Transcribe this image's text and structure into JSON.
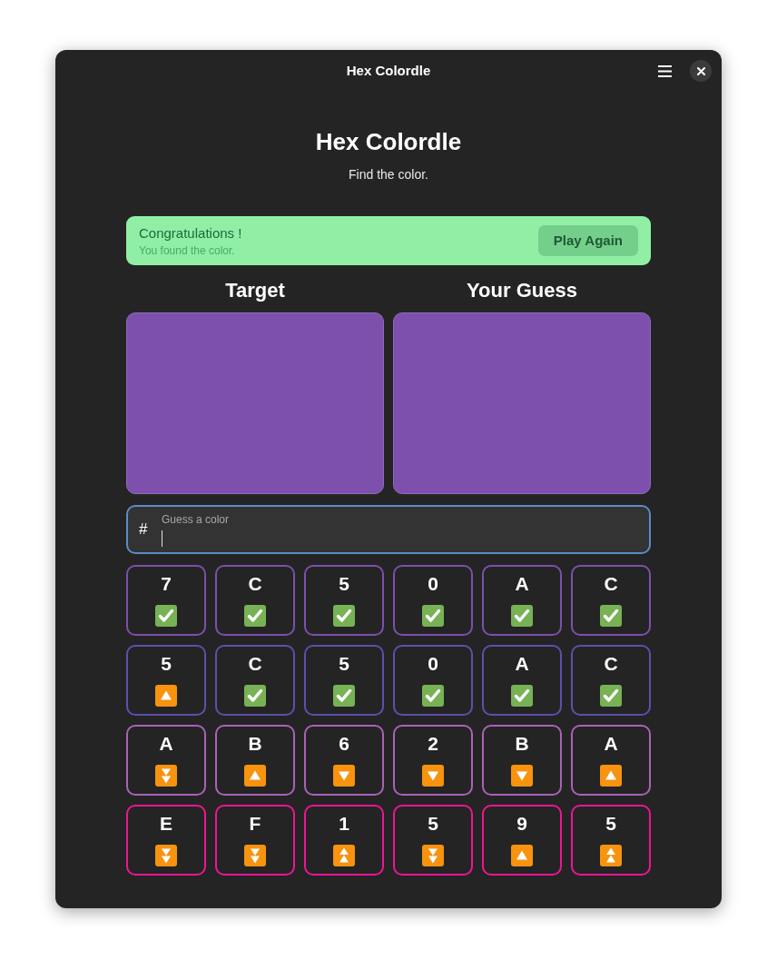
{
  "window": {
    "title": "Hex Colordle"
  },
  "header": {
    "title": "Hex Colordle",
    "subtitle": "Find the color."
  },
  "banner": {
    "title": "Congratulations !",
    "message": "You found the color.",
    "button": "Play Again"
  },
  "swatches": [
    {
      "label": "Target",
      "color": "#7c50ac"
    },
    {
      "label": "Your Guess",
      "color": "#7c50ac"
    }
  ],
  "guess_field": {
    "prefix": "#",
    "label": "Guess a color",
    "focused": true
  },
  "guesses": [
    {
      "color": "#7c50ac",
      "cells": [
        {
          "char": "7",
          "kind": "correct"
        },
        {
          "char": "C",
          "kind": "correct"
        },
        {
          "char": "5",
          "kind": "correct"
        },
        {
          "char": "0",
          "kind": "correct"
        },
        {
          "char": "A",
          "kind": "correct"
        },
        {
          "char": "C",
          "kind": "correct"
        }
      ]
    },
    {
      "color": "#5c50ac",
      "cells": [
        {
          "char": "5",
          "kind": "higher"
        },
        {
          "char": "C",
          "kind": "correct"
        },
        {
          "char": "5",
          "kind": "correct"
        },
        {
          "char": "0",
          "kind": "correct"
        },
        {
          "char": "A",
          "kind": "correct"
        },
        {
          "char": "C",
          "kind": "correct"
        }
      ]
    },
    {
      "color": "#ab62ba",
      "cells": [
        {
          "char": "A",
          "kind": "much_lower"
        },
        {
          "char": "B",
          "kind": "higher"
        },
        {
          "char": "6",
          "kind": "lower"
        },
        {
          "char": "2",
          "kind": "lower"
        },
        {
          "char": "B",
          "kind": "lower"
        },
        {
          "char": "A",
          "kind": "higher"
        }
      ]
    },
    {
      "color": "#ef1595",
      "cells": [
        {
          "char": "E",
          "kind": "much_lower"
        },
        {
          "char": "F",
          "kind": "much_lower"
        },
        {
          "char": "1",
          "kind": "much_higher"
        },
        {
          "char": "5",
          "kind": "much_lower"
        },
        {
          "char": "9",
          "kind": "higher"
        },
        {
          "char": "5",
          "kind": "much_higher"
        }
      ]
    }
  ]
}
